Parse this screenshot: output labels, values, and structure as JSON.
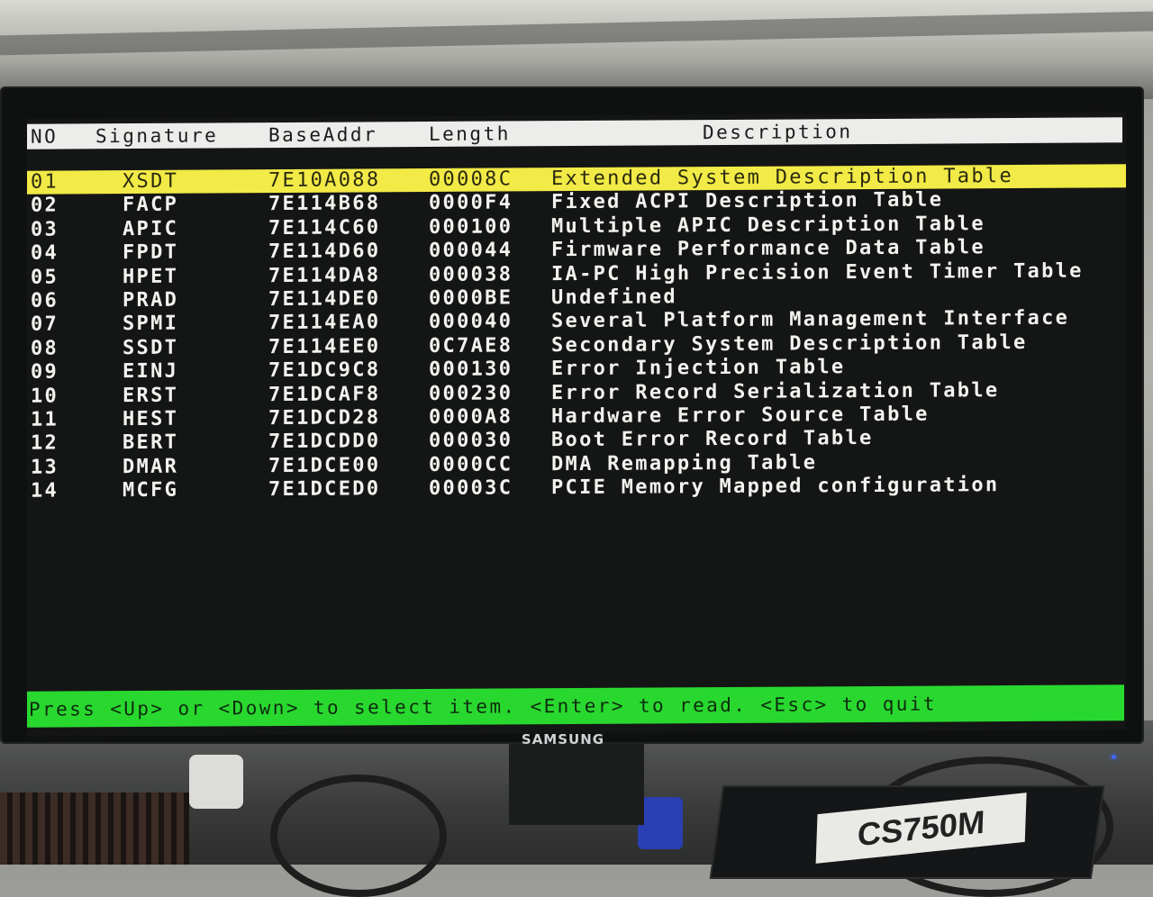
{
  "monitor": {
    "brand": "SAMSUNG"
  },
  "table": {
    "headers": {
      "no": "NO",
      "signature": "Signature",
      "base_addr": "BaseAddr",
      "length": "Length",
      "description": "Description"
    },
    "selected_index": 0,
    "rows": [
      {
        "no": "01",
        "signature": "XSDT",
        "base_addr": "7E10A088",
        "length": "00008C",
        "description": "Extended System Description Table"
      },
      {
        "no": "02",
        "signature": "FACP",
        "base_addr": "7E114B68",
        "length": "0000F4",
        "description": "Fixed ACPI Description Table"
      },
      {
        "no": "03",
        "signature": "APIC",
        "base_addr": "7E114C60",
        "length": "000100",
        "description": "Multiple APIC Description Table"
      },
      {
        "no": "04",
        "signature": "FPDT",
        "base_addr": "7E114D60",
        "length": "000044",
        "description": "Firmware Performance Data Table"
      },
      {
        "no": "05",
        "signature": "HPET",
        "base_addr": "7E114DA8",
        "length": "000038",
        "description": "IA-PC High Precision Event Timer Table"
      },
      {
        "no": "06",
        "signature": "PRAD",
        "base_addr": "7E114DE0",
        "length": "0000BE",
        "description": "Undefined"
      },
      {
        "no": "07",
        "signature": "SPMI",
        "base_addr": "7E114EA0",
        "length": "000040",
        "description": "Several Platform Management Interface"
      },
      {
        "no": "08",
        "signature": "SSDT",
        "base_addr": "7E114EE0",
        "length": "0C7AE8",
        "description": "Secondary System Description Table"
      },
      {
        "no": "09",
        "signature": "EINJ",
        "base_addr": "7E1DC9C8",
        "length": "000130",
        "description": "Error Injection Table"
      },
      {
        "no": "10",
        "signature": "ERST",
        "base_addr": "7E1DCAF8",
        "length": "000230",
        "description": "Error Record Serialization Table"
      },
      {
        "no": "11",
        "signature": "HEST",
        "base_addr": "7E1DCD28",
        "length": "0000A8",
        "description": "Hardware Error Source Table"
      },
      {
        "no": "12",
        "signature": "BERT",
        "base_addr": "7E1DCDD0",
        "length": "000030",
        "description": "Boot Error Record Table"
      },
      {
        "no": "13",
        "signature": "DMAR",
        "base_addr": "7E1DCE00",
        "length": "0000CC",
        "description": "DMA Remapping Table"
      },
      {
        "no": "14",
        "signature": "MCFG",
        "base_addr": "7E1DCED0",
        "length": "00003C",
        "description": "PCIE Memory Mapped configuration"
      }
    ]
  },
  "status_bar": {
    "text": "Press <Up> or <Down> to select item. <Enter> to read. <Esc> to quit"
  },
  "colors": {
    "header_bg": "#ececea",
    "selected_row_bg": "#f2ea46",
    "status_bar_bg": "#29d82f",
    "screen_bg": "#141515",
    "text": "#f2f2ee"
  }
}
